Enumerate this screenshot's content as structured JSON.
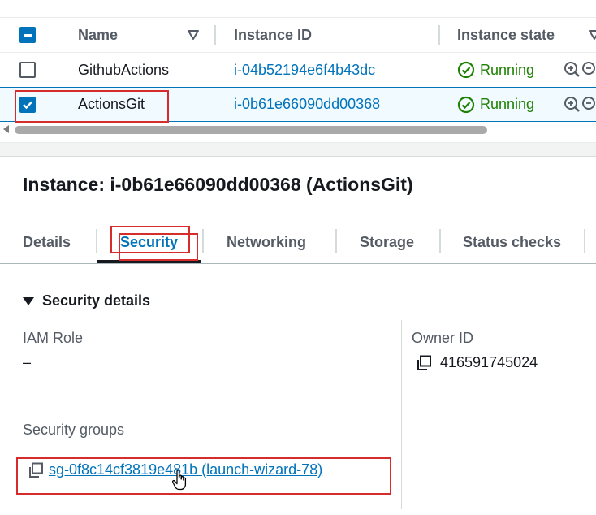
{
  "table": {
    "columns": {
      "name": "Name",
      "instance_id": "Instance ID",
      "instance_state": "Instance state"
    },
    "rows": [
      {
        "name": "GithubActions",
        "instance_id": "i-04b52194e6f4b43dc",
        "state": "Running",
        "selected": false
      },
      {
        "name": "ActionsGit",
        "instance_id": "i-0b61e66090dd00368",
        "state": "Running",
        "selected": true
      }
    ]
  },
  "details": {
    "title": "Instance: i-0b61e66090dd00368 (ActionsGit)",
    "tabs": [
      "Details",
      "Security",
      "Networking",
      "Storage",
      "Status checks"
    ],
    "active_tab": "Security",
    "section_title": "Security details",
    "iam_role_label": "IAM Role",
    "iam_role_value": "–",
    "owner_id_label": "Owner ID",
    "owner_id_value": "416591745024",
    "security_groups_label": "Security groups",
    "security_group_link": "sg-0f8c14cf3819e481b (launch-wizard-78)"
  },
  "colors": {
    "link": "#0073bb",
    "running": "#1d8102",
    "highlight": "#d62c2c",
    "selected_row_bg": "#f1faff"
  }
}
